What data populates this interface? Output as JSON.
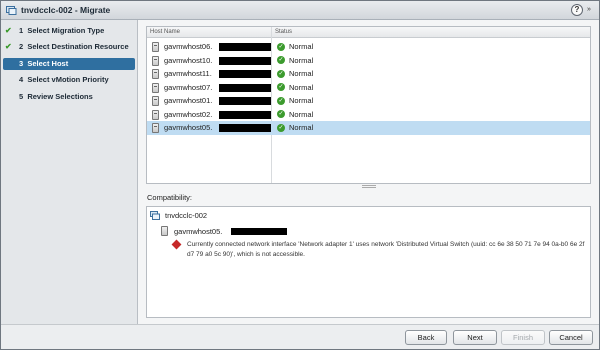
{
  "window": {
    "title": "tnvdcclc-002 - Migrate",
    "help_label": "?",
    "expand_label": "»"
  },
  "steps": [
    {
      "num": "1",
      "label": "Select Migration Type",
      "done": true
    },
    {
      "num": "2",
      "label": "Select Destination Resource",
      "done": true
    },
    {
      "num": "3",
      "label": "Select Host",
      "done": false,
      "active": true
    },
    {
      "num": "4",
      "label": "Select vMotion Priority",
      "done": false
    },
    {
      "num": "5",
      "label": "Review Selections",
      "done": false
    }
  ],
  "hosts_table": {
    "columns": [
      "Host Name",
      "Status"
    ],
    "rows": [
      {
        "host": "gavmwhost06.",
        "status": "Normal"
      },
      {
        "host": "gavmwhost10.",
        "status": "Normal"
      },
      {
        "host": "gavmwhost11.",
        "status": "Normal"
      },
      {
        "host": "gavmwhost07.",
        "status": "Normal"
      },
      {
        "host": "gavmwhost01.",
        "status": "Normal"
      },
      {
        "host": "gavmwhost02.",
        "status": "Normal"
      },
      {
        "host": "gavmwhost05.",
        "status": "Normal",
        "selected": true
      }
    ]
  },
  "compatibility": {
    "label": "Compatibility:",
    "vm_name": "tnvdcclc-002",
    "host_name": "gavmwhost05.",
    "message": "Currently connected network interface 'Network adapter 1' uses network 'Distributed Virtual Switch (uuid: cc 6e 38 50 71 7e 94 0a-b0 6e 2f d7 79 a0 5c 90)', which is not accessible."
  },
  "footer": {
    "back_label": "Back",
    "next_label": "Next",
    "finish_label": "Finish",
    "cancel_label": "Cancel"
  },
  "colors": {
    "accent": "#2f6fa0",
    "selected_row": "#bfdcf2",
    "ok": "#3c9b2e",
    "error": "#c62828"
  }
}
